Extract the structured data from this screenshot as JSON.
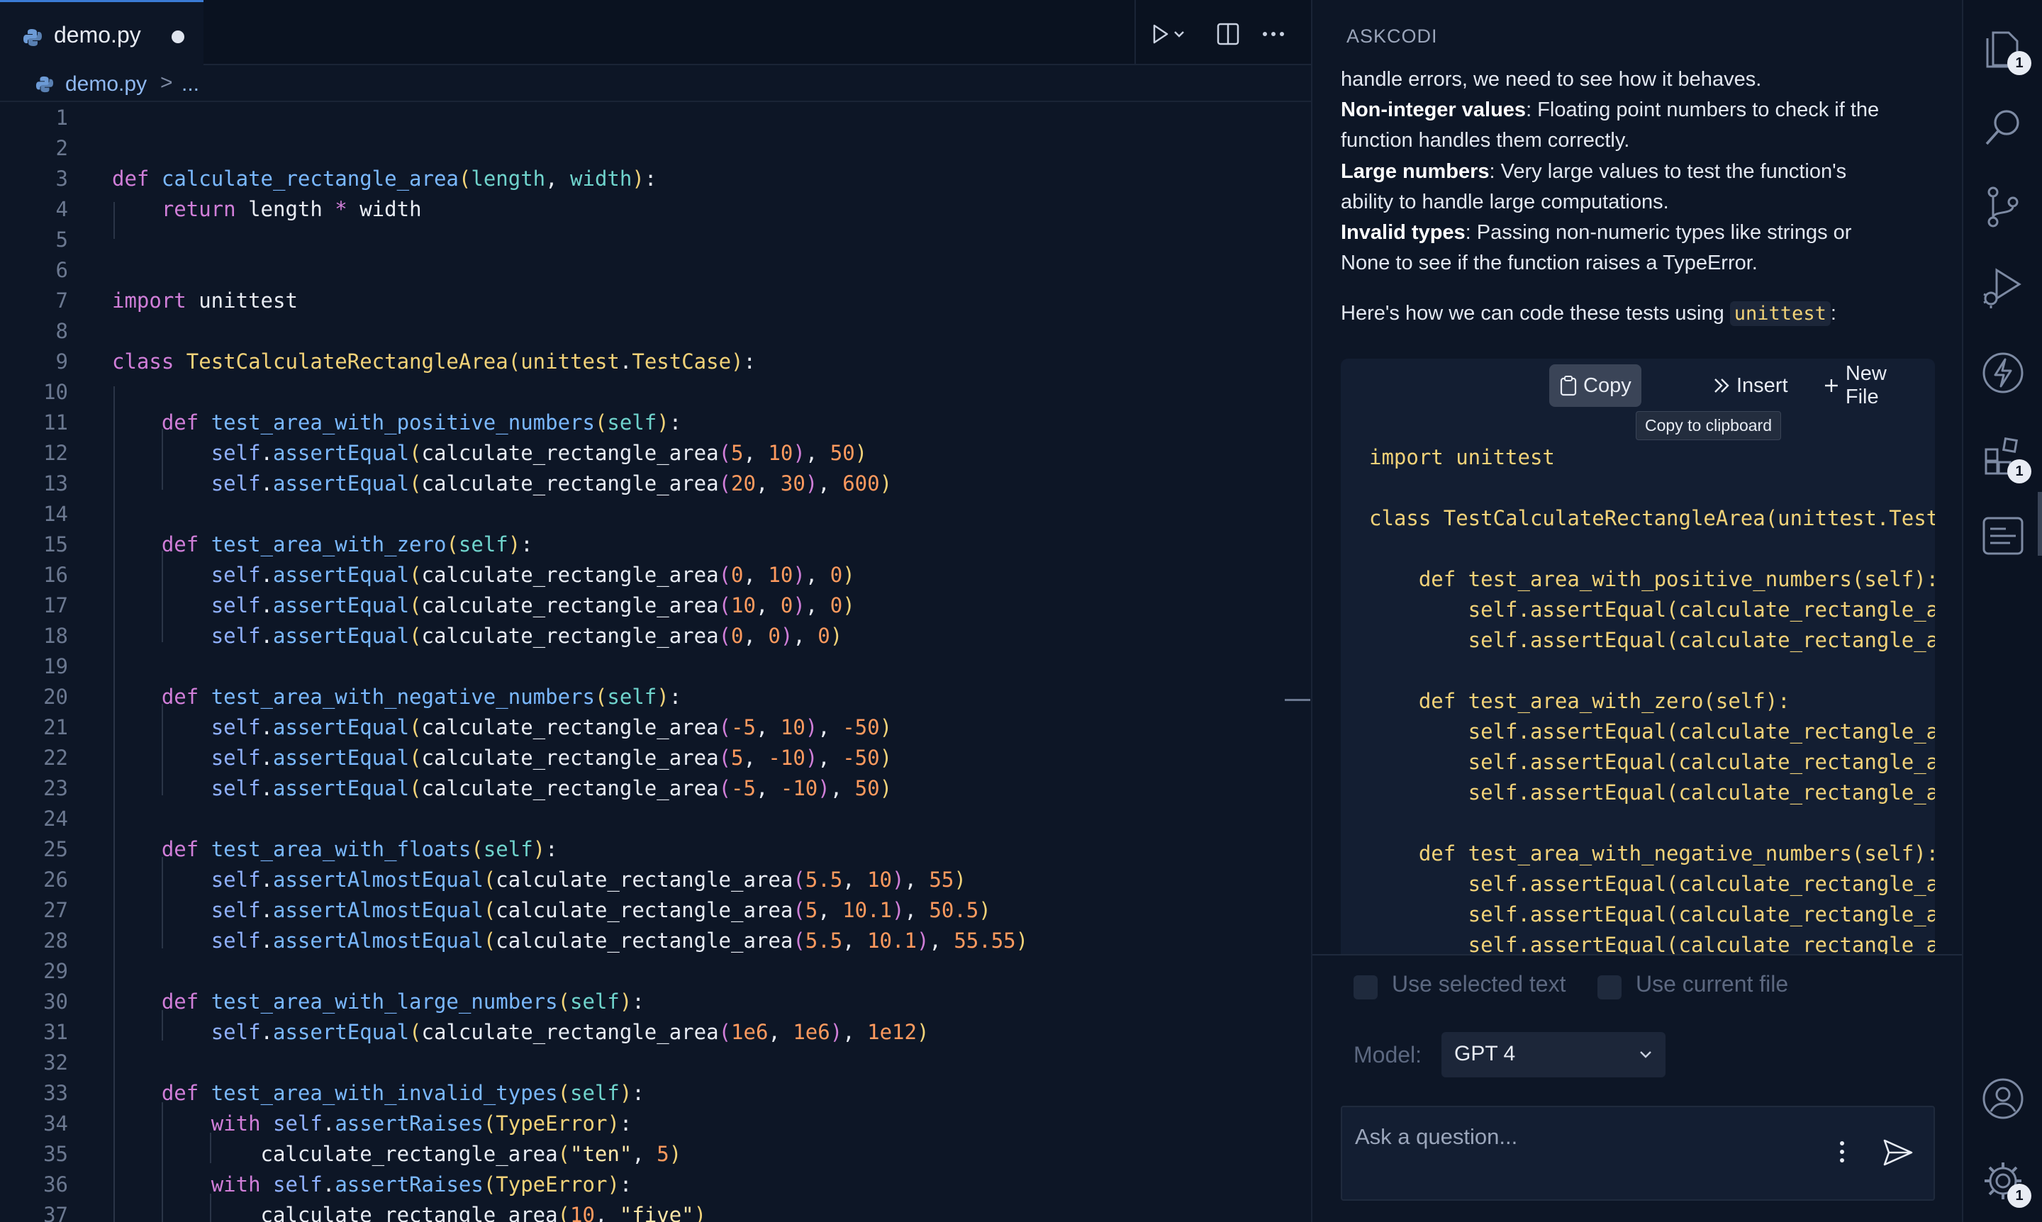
{
  "tab": {
    "filename": "demo.py"
  },
  "breadcrumb": {
    "file": "demo.py",
    "separator": ">",
    "more": "..."
  },
  "editor": {
    "line_numbers": [
      "1",
      "2",
      "3",
      "4",
      "5",
      "6",
      "7",
      "8",
      "9",
      "10",
      "11",
      "12",
      "13",
      "14",
      "15",
      "16",
      "17",
      "18",
      "19",
      "20",
      "21",
      "22",
      "23",
      "24",
      "25",
      "26",
      "27",
      "28",
      "29",
      "30",
      "31",
      "32",
      "33",
      "34",
      "35",
      "36",
      "37"
    ]
  },
  "panel": {
    "title": "ASKCODI",
    "para1": "handle errors, we need to see how it behaves.",
    "b_noninteger": "Non-integer values",
    "t_noninteger_1": ": Floating point numbers to check if the",
    "t_noninteger_2": "function handles them correctly.",
    "b_large": "Large numbers",
    "t_large_1": ": Very large values to test the function's",
    "t_large_2": "ability to handle large computations.",
    "b_invalid": "Invalid types",
    "t_invalid_1": ": Passing non-numeric types like strings or",
    "t_invalid_2": "None to see if the function raises a TypeError.",
    "howto_prefix": "Here's how we can code these tests using ",
    "howto_code": "unittest",
    "howto_suffix": ":",
    "copy_label": "Copy",
    "insert_label": "Insert",
    "newfile_label": "New File",
    "tooltip": "Copy to clipboard",
    "code_lines": [
      "import unittest",
      "",
      "class TestCalculateRectangleArea(unittest.Test",
      "",
      "    def test_area_with_positive_numbers(self):",
      "        self.assertEqual(calculate_rectangle_a",
      "        self.assertEqual(calculate_rectangle_a",
      "",
      "    def test_area_with_zero(self):",
      "        self.assertEqual(calculate_rectangle_a",
      "        self.assertEqual(calculate_rectangle_a",
      "        self.assertEqual(calculate_rectangle_a",
      "",
      "    def test_area_with_negative_numbers(self):",
      "        self.assertEqual(calculate_rectangle_a",
      "        self.assertEqual(calculate_rectangle_a",
      "        self.assertEqual(calculate_rectangle_a"
    ],
    "use_selected_text": "Use selected text",
    "use_current_file": "Use current file",
    "model_label": "Model:",
    "model_value": "GPT 4",
    "ask_placeholder": "Ask a question..."
  },
  "activity_badges": {
    "explorer": "1",
    "extensions": "1",
    "settings": "1"
  },
  "icons": [
    "python-file-icon",
    "run-icon",
    "chevron-down-icon",
    "split-editor-icon",
    "more-icon",
    "copy-icon",
    "insert-icon",
    "plus-icon",
    "send-icon",
    "explorer-icon",
    "search-icon",
    "source-control-icon",
    "run-debug-icon",
    "lightning-icon",
    "extensions-icon",
    "chat-panel-icon",
    "account-icon",
    "gear-icon"
  ]
}
